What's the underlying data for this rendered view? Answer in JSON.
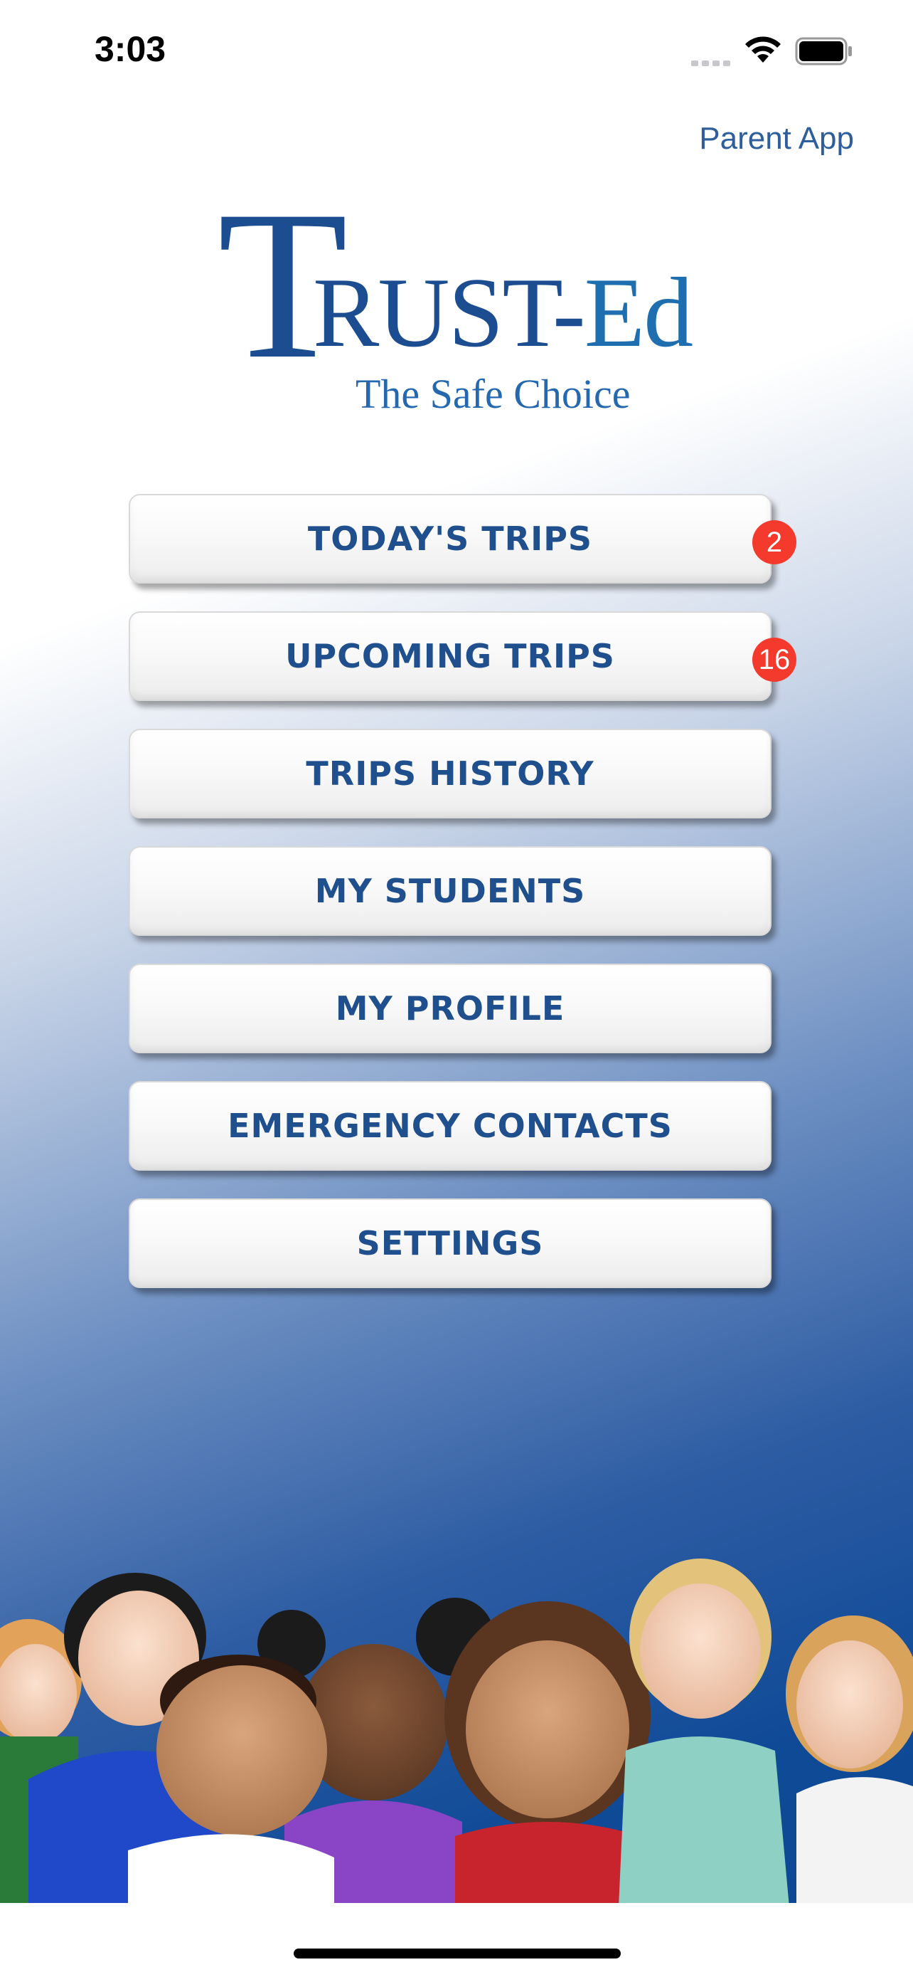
{
  "status_bar": {
    "time": "3:03"
  },
  "header": {
    "parent_app_label": "Parent App"
  },
  "logo": {
    "brand_first": "T",
    "brand_rest": "RUST-",
    "brand_ed": "Ed",
    "tagline": "The Safe Choice"
  },
  "menu": {
    "items": [
      {
        "label": "TODAY'S TRIPS",
        "badge": "2"
      },
      {
        "label": "UPCOMING TRIPS",
        "badge": "16"
      },
      {
        "label": "TRIPS HISTORY"
      },
      {
        "label": "MY STUDENTS"
      },
      {
        "label": "MY PROFILE"
      },
      {
        "label": "EMERGENCY CONTACTS"
      },
      {
        "label": "SETTINGS"
      }
    ]
  },
  "colors": {
    "brand_blue": "#1c4d91",
    "button_text": "#1f4f8d",
    "badge_red": "#f33a2c",
    "link_blue": "#2e5f9c"
  }
}
